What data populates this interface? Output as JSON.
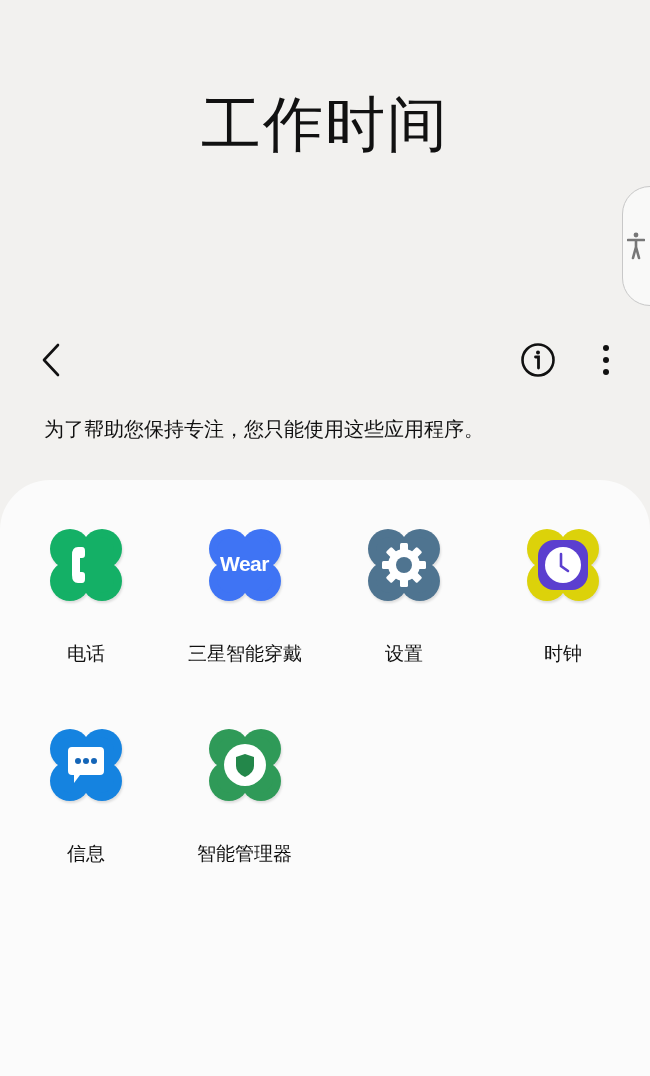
{
  "title": "工作时间",
  "description": "为了帮助您保持专注，您只能使用这些应用程序。",
  "apps": [
    {
      "label": "电话",
      "kind": "phone",
      "color": "#14b066"
    },
    {
      "label": "三星智能穿戴",
      "kind": "wear",
      "color": "#3f74f4",
      "icon_text": "Wear"
    },
    {
      "label": "设置",
      "kind": "settings",
      "color": "#4f7490"
    },
    {
      "label": "时钟",
      "kind": "clock",
      "color": "#dcd20a"
    },
    {
      "label": "信息",
      "kind": "messages",
      "color": "#1583e0"
    },
    {
      "label": "智能管理器",
      "kind": "shield",
      "color": "#2f9a58"
    }
  ]
}
